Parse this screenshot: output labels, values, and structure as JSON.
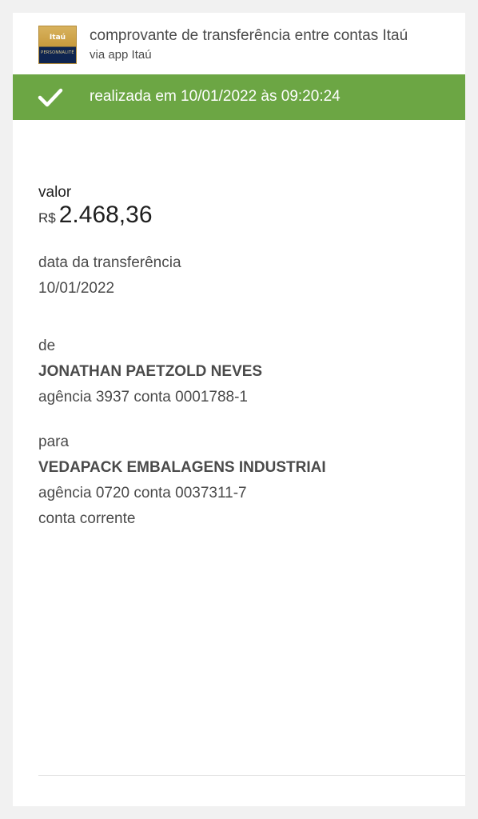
{
  "header": {
    "logo_brand": "Itaú",
    "logo_sub": "PERSONNALITÉ",
    "title": "comprovante de transferência entre contas Itaú",
    "subtitle": "via app Itaú"
  },
  "status": {
    "text": "realizada em 10/01/2022 às 09:20:24",
    "color": "#6ca644",
    "icon": "check-icon"
  },
  "valor": {
    "label": "valor",
    "currency": "R$",
    "amount": "2.468,36"
  },
  "data_transferencia": {
    "label": "data da transferência",
    "value": "10/01/2022"
  },
  "de": {
    "label": "de",
    "name": "JONATHAN PAETZOLD NEVES",
    "account": "agência 3937 conta 0001788-1"
  },
  "para": {
    "label": "para",
    "name": "VEDAPACK EMBALAGENS INDUSTRIAI",
    "account": "agência 0720 conta 0037311-7",
    "account_type": "conta corrente"
  }
}
